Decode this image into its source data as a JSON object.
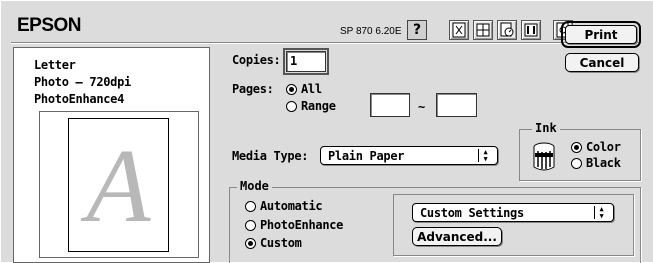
{
  "header": {
    "brand": "EPSON",
    "version": "SP 870 6.20E",
    "help_label": "?"
  },
  "buttons": {
    "print": "Print",
    "cancel": "Cancel",
    "advanced": "Advanced..."
  },
  "summary": {
    "paper_size": "Letter",
    "resolution": "Photo – 720dpi",
    "enhance": "PhotoEnhance4",
    "preview_letter": "A"
  },
  "copies": {
    "label": "Copies:",
    "value": "1"
  },
  "pages": {
    "label": "Pages:",
    "all_label": "All",
    "range_label": "Range",
    "range_from": "",
    "range_separator": "~",
    "range_to": "",
    "selected": "all"
  },
  "media": {
    "label": "Media Type:",
    "value": "Plain Paper"
  },
  "ink": {
    "title": "Ink",
    "color_label": "Color",
    "black_label": "Black",
    "selected": "color"
  },
  "mode": {
    "title": "Mode",
    "automatic_label": "Automatic",
    "photoenhance_label": "PhotoEnhance",
    "custom_label": "Custom",
    "selected": "custom",
    "settings_value": "Custom Settings"
  },
  "icons": [
    "help-icon",
    "watermark-icon",
    "layout-icon",
    "page-setup-icon",
    "background-printing-icon",
    "preview-icon",
    "ink-cartridge-icon",
    "popup-arrows-icon"
  ]
}
